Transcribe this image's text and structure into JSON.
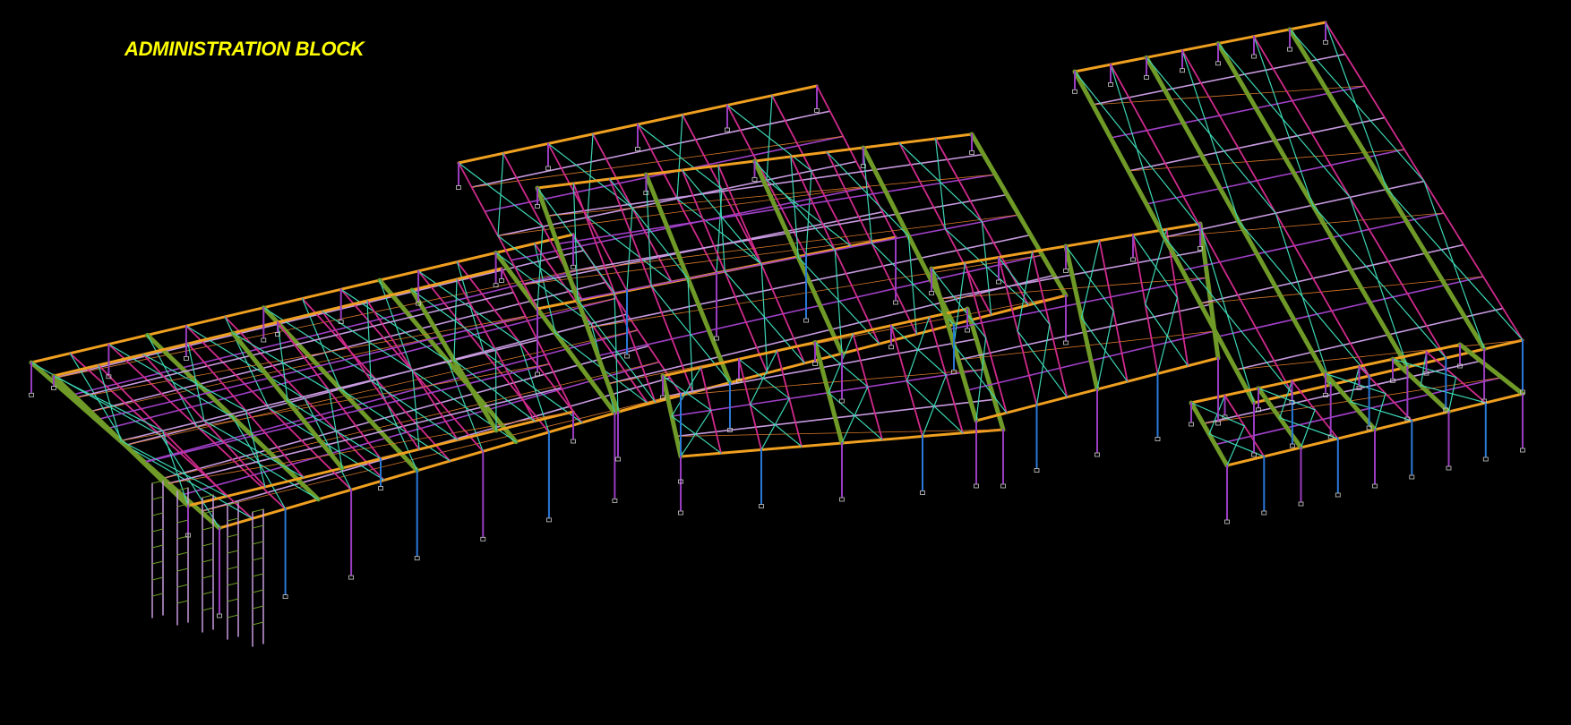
{
  "title": "ADMINISTRATION BLOCK",
  "colors": {
    "background": "#000000",
    "title": "#ffff00",
    "truss_green": "#6f9a28",
    "rafter_magenta": "#d02a8c",
    "purlin_violet": "#a040c8",
    "light_violet": "#c89ae0",
    "bracing_cyan": "#3cd6b4",
    "bracing_blue": "#2a90e0",
    "eave_orange": "#f0a020",
    "secondary_orange": "#d8782a",
    "column_purple": "#9a3cc0",
    "column_blue": "#2a78d8"
  }
}
